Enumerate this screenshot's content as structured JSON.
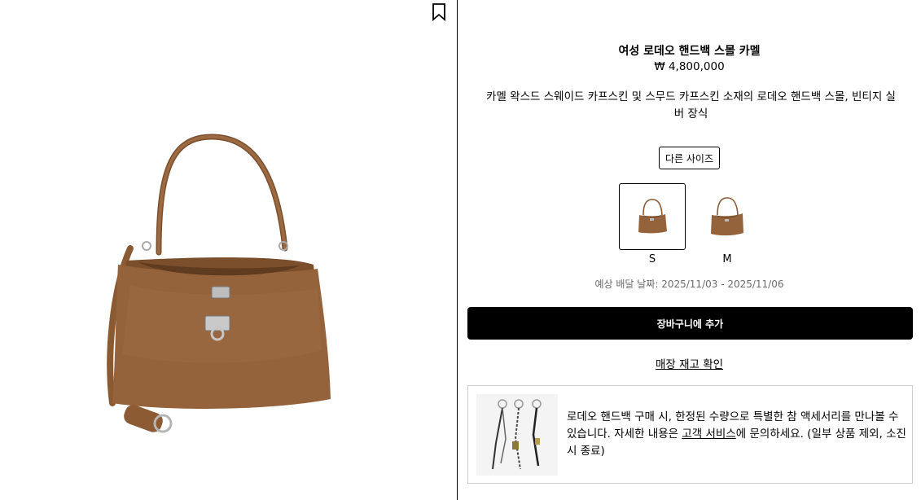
{
  "product": {
    "title": "여성 로데오 핸드백 스몰 카멜",
    "price": "₩ 4,800,000",
    "description": "카멜 왁스드 스웨이드 카프스킨 및 스무드 카프스킨 소재의 로데오 핸드백 스몰, 빈티지 실버 장식"
  },
  "sizes": {
    "button_label": "다른 사이즈",
    "options": [
      {
        "label": "S",
        "selected": true
      },
      {
        "label": "M",
        "selected": false
      }
    ]
  },
  "delivery": {
    "text": "예상 배달 날짜: 2025/11/03 - 2025/11/06"
  },
  "actions": {
    "add_to_cart": "장바구니에 추가",
    "check_stock": "매장 재고 확인"
  },
  "promo": {
    "text_before": "로데오 핸드백 구매 시, 한정된 수량으로 특별한 참 액세서리를 만나볼 수 있습니다. 자세한 내용은 ",
    "link": "고객 서비스",
    "text_after": "에 문의하세요. (일부 상품 제외, 소진 시 종료)"
  },
  "colors": {
    "bag": "#8f5f37",
    "bag_dark": "#6e4526",
    "accent": "#000000",
    "delivery_text": "#6b6b6b"
  },
  "icons": {
    "bookmark": "bookmark-icon"
  }
}
